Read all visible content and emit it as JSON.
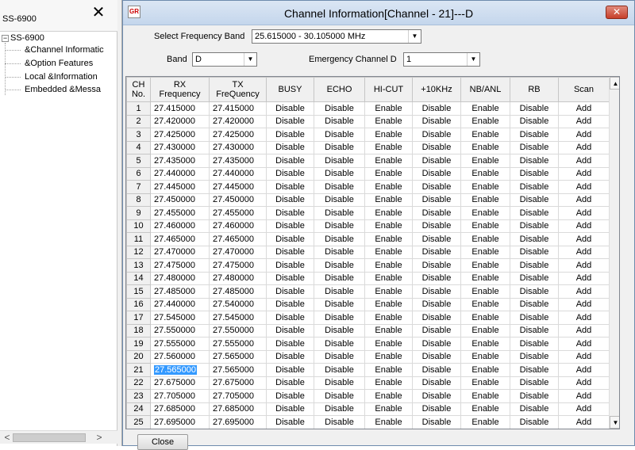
{
  "left_panel": {
    "title": "SS-6900",
    "close_glyph": "✕",
    "tree_root": {
      "expander": "−",
      "label": "SS-6900"
    },
    "tree_items": [
      "&Channel Informatic",
      "&Option Features",
      "Local &Information",
      "Embedded &Messa"
    ],
    "hscroll": {
      "left_arrow": "<",
      "right_arrow": ">"
    }
  },
  "dialog": {
    "title": "Channel Information[Channel - 21]---D",
    "icon_label": "GR",
    "close_glyph": "✕",
    "select_band_label": "Select Frequency Band",
    "select_band_value": "25.615000 - 30.105000 MHz",
    "band_label": "Band",
    "band_value": "D",
    "emergency_label": "Emergency Channel D",
    "emergency_value": "1",
    "close_button": "Close"
  },
  "icons": {
    "dropdown_arrow": "▼",
    "scroll_up": "▲",
    "scroll_down": "▼"
  },
  "grid": {
    "columns": [
      {
        "line1": "CH",
        "line2": "No."
      },
      {
        "line1": "RX",
        "line2": "Frequency"
      },
      {
        "line1": "TX",
        "line2": "FreQuency"
      },
      {
        "line1": "BUSY",
        "line2": ""
      },
      {
        "line1": "ECHO",
        "line2": ""
      },
      {
        "line1": "HI-CUT",
        "line2": ""
      },
      {
        "line1": "+10KHz",
        "line2": ""
      },
      {
        "line1": "NB/ANL",
        "line2": ""
      },
      {
        "line1": "RB",
        "line2": ""
      },
      {
        "line1": "Scan",
        "line2": ""
      }
    ],
    "selected_row": 21,
    "rows": [
      [
        "1",
        "27.415000",
        "27.415000",
        "Disable",
        "Disable",
        "Enable",
        "Disable",
        "Enable",
        "Disable",
        "Add"
      ],
      [
        "2",
        "27.420000",
        "27.420000",
        "Disable",
        "Disable",
        "Enable",
        "Disable",
        "Enable",
        "Disable",
        "Add"
      ],
      [
        "3",
        "27.425000",
        "27.425000",
        "Disable",
        "Disable",
        "Enable",
        "Disable",
        "Enable",
        "Disable",
        "Add"
      ],
      [
        "4",
        "27.430000",
        "27.430000",
        "Disable",
        "Disable",
        "Enable",
        "Disable",
        "Enable",
        "Disable",
        "Add"
      ],
      [
        "5",
        "27.435000",
        "27.435000",
        "Disable",
        "Disable",
        "Enable",
        "Disable",
        "Enable",
        "Disable",
        "Add"
      ],
      [
        "6",
        "27.440000",
        "27.440000",
        "Disable",
        "Disable",
        "Enable",
        "Disable",
        "Enable",
        "Disable",
        "Add"
      ],
      [
        "7",
        "27.445000",
        "27.445000",
        "Disable",
        "Disable",
        "Enable",
        "Disable",
        "Enable",
        "Disable",
        "Add"
      ],
      [
        "8",
        "27.450000",
        "27.450000",
        "Disable",
        "Disable",
        "Enable",
        "Disable",
        "Enable",
        "Disable",
        "Add"
      ],
      [
        "9",
        "27.455000",
        "27.455000",
        "Disable",
        "Disable",
        "Enable",
        "Disable",
        "Enable",
        "Disable",
        "Add"
      ],
      [
        "10",
        "27.460000",
        "27.460000",
        "Disable",
        "Disable",
        "Enable",
        "Disable",
        "Enable",
        "Disable",
        "Add"
      ],
      [
        "11",
        "27.465000",
        "27.465000",
        "Disable",
        "Disable",
        "Enable",
        "Disable",
        "Enable",
        "Disable",
        "Add"
      ],
      [
        "12",
        "27.470000",
        "27.470000",
        "Disable",
        "Disable",
        "Enable",
        "Disable",
        "Enable",
        "Disable",
        "Add"
      ],
      [
        "13",
        "27.475000",
        "27.475000",
        "Disable",
        "Disable",
        "Enable",
        "Disable",
        "Enable",
        "Disable",
        "Add"
      ],
      [
        "14",
        "27.480000",
        "27.480000",
        "Disable",
        "Disable",
        "Enable",
        "Disable",
        "Enable",
        "Disable",
        "Add"
      ],
      [
        "15",
        "27.485000",
        "27.485000",
        "Disable",
        "Disable",
        "Enable",
        "Disable",
        "Enable",
        "Disable",
        "Add"
      ],
      [
        "16",
        "27.440000",
        "27.540000",
        "Disable",
        "Disable",
        "Enable",
        "Disable",
        "Enable",
        "Disable",
        "Add"
      ],
      [
        "17",
        "27.545000",
        "27.545000",
        "Disable",
        "Disable",
        "Enable",
        "Disable",
        "Enable",
        "Disable",
        "Add"
      ],
      [
        "18",
        "27.550000",
        "27.550000",
        "Disable",
        "Disable",
        "Enable",
        "Disable",
        "Enable",
        "Disable",
        "Add"
      ],
      [
        "19",
        "27.555000",
        "27.555000",
        "Disable",
        "Disable",
        "Enable",
        "Disable",
        "Enable",
        "Disable",
        "Add"
      ],
      [
        "20",
        "27.560000",
        "27.565000",
        "Disable",
        "Disable",
        "Enable",
        "Disable",
        "Enable",
        "Disable",
        "Add"
      ],
      [
        "21",
        "27.565000",
        "27.565000",
        "Disable",
        "Disable",
        "Enable",
        "Disable",
        "Enable",
        "Disable",
        "Add"
      ],
      [
        "22",
        "27.675000",
        "27.675000",
        "Disable",
        "Disable",
        "Enable",
        "Disable",
        "Enable",
        "Disable",
        "Add"
      ],
      [
        "23",
        "27.705000",
        "27.705000",
        "Disable",
        "Disable",
        "Enable",
        "Disable",
        "Enable",
        "Disable",
        "Add"
      ],
      [
        "24",
        "27.685000",
        "27.685000",
        "Disable",
        "Disable",
        "Enable",
        "Disable",
        "Enable",
        "Disable",
        "Add"
      ],
      [
        "25",
        "27.695000",
        "27.695000",
        "Disable",
        "Disable",
        "Enable",
        "Disable",
        "Enable",
        "Disable",
        "Add"
      ]
    ]
  }
}
